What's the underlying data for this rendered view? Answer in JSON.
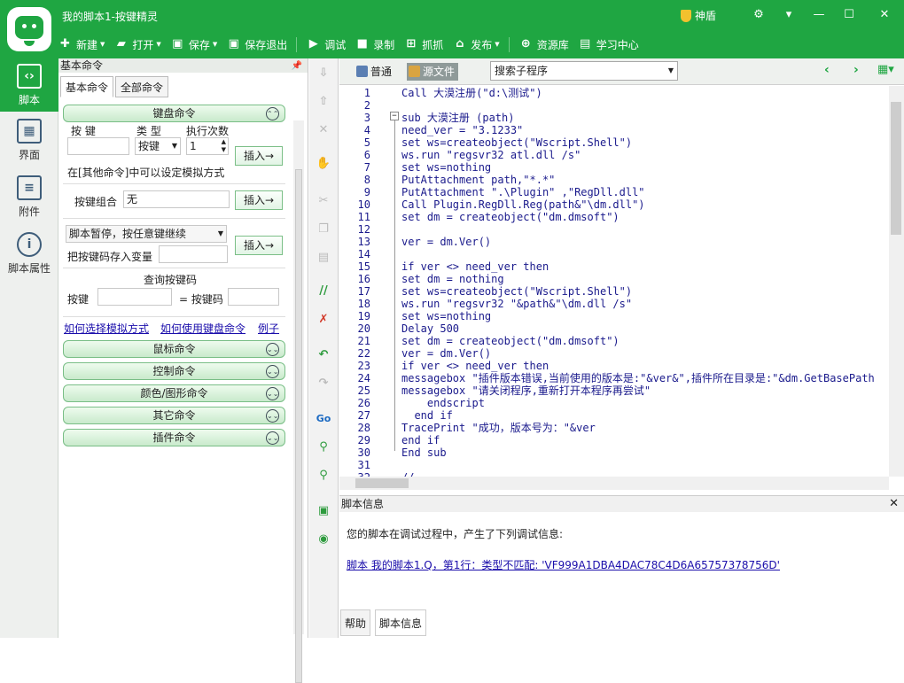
{
  "window": {
    "title": "我的脚本1-按键精灵",
    "shendun": "神盾"
  },
  "toolbar": [
    {
      "label": "新建",
      "icon": "plus-icon",
      "dropdown": true
    },
    {
      "label": "打开",
      "icon": "folder-icon",
      "dropdown": true
    },
    {
      "label": "保存",
      "icon": "save-icon",
      "dropdown": true
    },
    {
      "label": "保存退出",
      "icon": "save-exit-icon",
      "dropdown": false
    },
    {
      "label": "调试",
      "icon": "play-icon",
      "dropdown": false
    },
    {
      "label": "录制",
      "icon": "record-icon",
      "dropdown": false
    },
    {
      "label": "抓抓",
      "icon": "grab-icon",
      "dropdown": false
    },
    {
      "label": "发布",
      "icon": "publish-icon",
      "dropdown": true
    },
    {
      "label": "资源库",
      "icon": "library-icon",
      "dropdown": false
    },
    {
      "label": "学习中心",
      "icon": "learning-icon",
      "dropdown": false
    }
  ],
  "leftnav": [
    {
      "label": "脚本",
      "icon": "script-icon",
      "active": true
    },
    {
      "label": "界面",
      "icon": "ui-icon",
      "active": false
    },
    {
      "label": "附件",
      "icon": "attachment-icon",
      "active": false
    },
    {
      "label": "脚本属性",
      "icon": "info-icon",
      "active": false
    }
  ],
  "cmdpanel": {
    "header": "基本命令",
    "tabs": [
      "基本命令",
      "全部命令"
    ],
    "keyboard": {
      "title": "键盘命令",
      "col_key": "按 键",
      "col_type": "类 型",
      "col_count": "执行次数",
      "type_value": "按键",
      "count_value": "1",
      "insert": "插入→",
      "hint": "在[其他命令]中可以设定模拟方式",
      "combo_label": "按键组合",
      "combo_value": "无",
      "pause_value": "脚本暂停，按任意键继续",
      "save_label": "把按键码存入变量",
      "query_title": "查询按键码",
      "query_key": "按键",
      "query_code": "= 按键码"
    },
    "links": [
      "如何选择模拟方式",
      "如何使用键盘命令",
      "例子"
    ],
    "groups": [
      "鼠标命令",
      "控制命令",
      "颜色/图形命令",
      "其它命令",
      "插件命令"
    ]
  },
  "editor": {
    "tab_normal": "普通",
    "tab_source": "源文件",
    "sub_select": "搜索子程序",
    "lines": [
      "Call 大漠注册(\"d:\\测试\")",
      "",
      "sub 大漠注册 (path)",
      "need_ver = \"3.1233\"",
      "set ws=createobject(\"Wscript.Shell\")",
      "ws.run \"regsvr32 atl.dll /s\"",
      "set ws=nothing",
      "PutAttachment path,\"*.*\"",
      "PutAttachment \".\\Plugin\" ,\"RegDll.dll\"",
      "Call Plugin.RegDll.Reg(path&\"\\dm.dll\")",
      "set dm = createobject(\"dm.dmsoft\")",
      "",
      "ver = dm.Ver()",
      "",
      "if ver <> need_ver then",
      "set dm = nothing",
      "set ws=createobject(\"Wscript.Shell\")",
      "ws.run \"regsvr32 \"&path&\"\\dm.dll /s\"",
      "set ws=nothing",
      "Delay 500",
      "set dm = createobject(\"dm.dmsoft\")",
      "ver = dm.Ver()",
      "if ver <> need_ver then",
      "messagebox \"插件版本错误,当前使用的版本是:\"&ver&\",插件所在目录是:\"&dm.GetBasePath",
      "messagebox \"请关闭程序,重新打开本程序再尝试\"",
      "    endscript",
      "  end if",
      "TracePrint \"成功，版本号为：\"&ver",
      "end if",
      "End sub",
      "",
      "//"
    ]
  },
  "info": {
    "title": "脚本信息",
    "message": "您的脚本在调试过程中，产生了下列调试信息:",
    "error_link": "脚本 我的脚本1.Q，第1行：类型不匹配: 'VF999A1DBA4DAC78C4D6A65757378756D'",
    "tabs": [
      "帮助",
      "脚本信息"
    ]
  },
  "colors": {
    "brand": "#1fa642",
    "code": "#1a1a8c",
    "link": "#1a0dab"
  }
}
